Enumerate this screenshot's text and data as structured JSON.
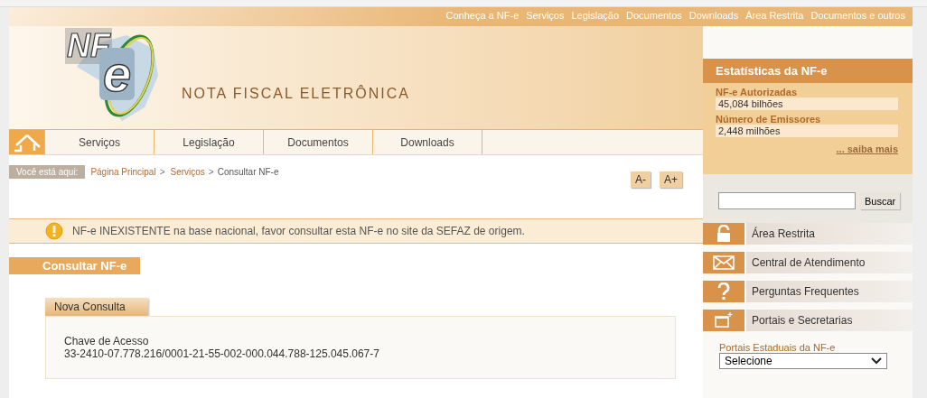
{
  "top_links": [
    "Conheça a NF-e",
    "Serviços",
    "Legislação",
    "Documentos",
    "Downloads",
    "Área Restrita",
    "Documentos e outros"
  ],
  "logo": {
    "mark": "NF",
    "letter": "e",
    "title": "NOTA FISCAL ELETRÔNICA"
  },
  "nav": {
    "items": [
      "Serviços",
      "Legislação",
      "Documentos",
      "Downloads"
    ]
  },
  "breadcrumb": {
    "label": "Você está aqui:",
    "links": [
      "Página Principal",
      "Serviços"
    ],
    "separator": ">",
    "current": "Consultar NF-e"
  },
  "font_buttons": [
    "A-",
    "A+"
  ],
  "alert": "NF-e INEXISTENTE na base nacional, favor consultar esta NF-e no site da SEFAZ de origem.",
  "section_title": "Consultar NF-e",
  "panel": {
    "tab": "Nova Consulta",
    "field_label": "Chave de Acesso",
    "field_value": "33-2410-07.778.216/0001-21-55-002-000.044.788-125.045.067-7"
  },
  "stats": {
    "title": "Estatísticas da NF-e",
    "items": [
      {
        "label": "NF-e Autorizadas",
        "value": "45,084 bilhões"
      },
      {
        "label": "Número de Emissores",
        "value": "2,448 milhões"
      }
    ],
    "more": "... saiba mais"
  },
  "search": {
    "button": "Buscar"
  },
  "side_menu": [
    {
      "kind": "lock",
      "label": "Área Restrita"
    },
    {
      "kind": "mail",
      "label": "Central de Atendimento"
    },
    {
      "kind": "question",
      "label": "Perguntas Frequentes"
    },
    {
      "kind": "window",
      "label": "Portais e Secretarias"
    }
  ],
  "portals": {
    "label": "Portais Estaduais da NF-e",
    "select": "Selecione"
  }
}
